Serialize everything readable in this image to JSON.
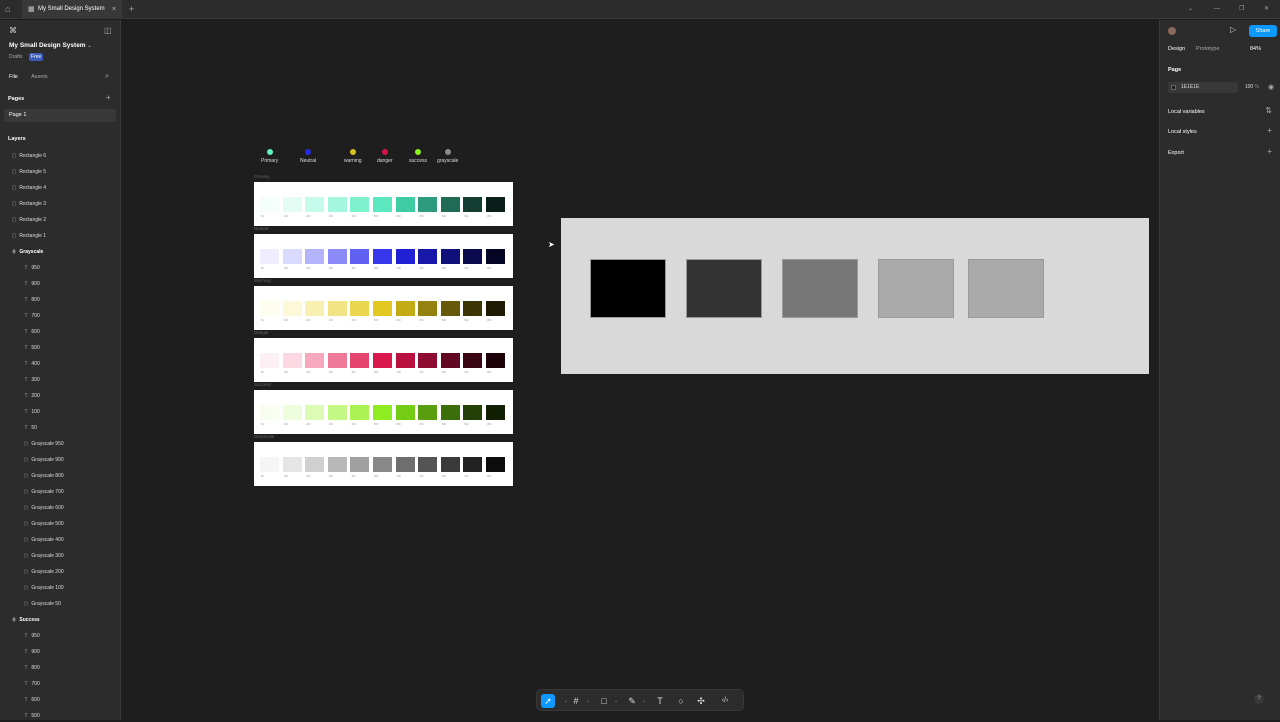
{
  "titlebar": {
    "tab_title": "My Small Design System",
    "new_tab": "+",
    "home_icon": "⌂",
    "close": "×"
  },
  "left_panel": {
    "project_name": "My Small Design System",
    "location": "Drafts",
    "plan_badge": "Free",
    "tabs": [
      "File",
      "Assets"
    ],
    "pages_heading": "Pages",
    "current_page": "Page 1",
    "layers_heading": "Layers",
    "layers": [
      {
        "name": "Rectangle 6",
        "type": "rect",
        "indent": 1
      },
      {
        "name": "Rectangle 5",
        "type": "rect",
        "indent": 1
      },
      {
        "name": "Rectangle 4",
        "type": "rect",
        "indent": 1
      },
      {
        "name": "Rectangle 3",
        "type": "rect",
        "indent": 1
      },
      {
        "name": "Rectangle 2",
        "type": "rect",
        "indent": 1
      },
      {
        "name": "Rectangle 1",
        "type": "rect",
        "indent": 1
      },
      {
        "name": "Grayscale",
        "type": "group",
        "indent": 1
      },
      {
        "name": "950",
        "type": "text",
        "indent": 2
      },
      {
        "name": "900",
        "type": "text",
        "indent": 2
      },
      {
        "name": "800",
        "type": "text",
        "indent": 2
      },
      {
        "name": "700",
        "type": "text",
        "indent": 2
      },
      {
        "name": "600",
        "type": "text",
        "indent": 2
      },
      {
        "name": "500",
        "type": "text",
        "indent": 2
      },
      {
        "name": "400",
        "type": "text",
        "indent": 2
      },
      {
        "name": "300",
        "type": "text",
        "indent": 2
      },
      {
        "name": "200",
        "type": "text",
        "indent": 2
      },
      {
        "name": "100",
        "type": "text",
        "indent": 2
      },
      {
        "name": "50",
        "type": "text",
        "indent": 2
      },
      {
        "name": "Grayscale 950",
        "type": "rect",
        "indent": 2
      },
      {
        "name": "Grayscale 900",
        "type": "rect",
        "indent": 2
      },
      {
        "name": "Grayscale 800",
        "type": "rect",
        "indent": 2
      },
      {
        "name": "Grayscale 700",
        "type": "rect",
        "indent": 2
      },
      {
        "name": "Grayscale 600",
        "type": "rect",
        "indent": 2
      },
      {
        "name": "Grayscale 500",
        "type": "rect",
        "indent": 2
      },
      {
        "name": "Grayscale 400",
        "type": "rect",
        "indent": 2
      },
      {
        "name": "Grayscale 300",
        "type": "rect",
        "indent": 2
      },
      {
        "name": "Grayscale 200",
        "type": "rect",
        "indent": 2
      },
      {
        "name": "Grayscale 100",
        "type": "rect",
        "indent": 2
      },
      {
        "name": "Grayscale 50",
        "type": "rect",
        "indent": 2
      },
      {
        "name": "Success",
        "type": "group",
        "indent": 1
      },
      {
        "name": "950",
        "type": "text",
        "indent": 2
      },
      {
        "name": "900",
        "type": "text",
        "indent": 2
      },
      {
        "name": "800",
        "type": "text",
        "indent": 2
      },
      {
        "name": "700",
        "type": "text",
        "indent": 2
      },
      {
        "name": "600",
        "type": "text",
        "indent": 2
      },
      {
        "name": "500",
        "type": "text",
        "indent": 2
      }
    ]
  },
  "right_panel": {
    "tabs": [
      "Design",
      "Prototype"
    ],
    "zoom": "84%",
    "share_label": "Share",
    "page_heading": "Page",
    "page_color": "1E1E1E",
    "page_opacity": "100",
    "percent": "%",
    "sections": [
      "Local variables",
      "Local styles",
      "Export"
    ]
  },
  "canvas": {
    "legend": [
      {
        "label": "Primary",
        "color": "#5ef2c8"
      },
      {
        "label": "Neutral",
        "color": "#2a2ae6"
      },
      {
        "label": "warning",
        "color": "#d8c21a"
      },
      {
        "label": "danger",
        "color": "#d4154a"
      },
      {
        "label": "success",
        "color": "#8ef21a"
      },
      {
        "label": "grayscale",
        "color": "#8a8a8a"
      }
    ],
    "palettes": [
      {
        "name": "Primary",
        "colors": [
          "#f4fefb",
          "#e3fdf5",
          "#c5fbeb",
          "#a2f7de",
          "#7ef1cf",
          "#5ce8bf",
          "#3fcca2",
          "#2e9c7c",
          "#1f6b56",
          "#143d31",
          "#0a1f19"
        ]
      },
      {
        "name": "Neutral",
        "colors": [
          "#eeeeff",
          "#dadaff",
          "#b4b4fc",
          "#8a8af8",
          "#6060f2",
          "#3636ea",
          "#2020d4",
          "#1818a8",
          "#10107a",
          "#0a0a4c",
          "#050526"
        ]
      },
      {
        "name": "Warning",
        "colors": [
          "#fefdf0",
          "#fcf8d8",
          "#f8f0b0",
          "#f2e484",
          "#ebd650",
          "#e2c820",
          "#c2ab14",
          "#93820f",
          "#66590a",
          "#3c3506",
          "#1e1a03"
        ]
      },
      {
        "name": "Danger",
        "colors": [
          "#fdf0f4",
          "#fbd8e2",
          "#f5a8be",
          "#ee7898",
          "#e4456f",
          "#d8174d",
          "#b8103f",
          "#8e0c31",
          "#620822",
          "#3a0514",
          "#1d020a"
        ]
      },
      {
        "name": "Success",
        "colors": [
          "#f8fef0",
          "#eefddc",
          "#dcfbb4",
          "#c4f885",
          "#aaf352",
          "#8eec20",
          "#74cc14",
          "#589e0f",
          "#3c6e0a",
          "#234106",
          "#112003"
        ]
      },
      {
        "name": "Grayscale",
        "colors": [
          "#f5f5f5",
          "#e5e5e5",
          "#d0d0d0",
          "#b8b8b8",
          "#a0a0a0",
          "#888888",
          "#6e6e6e",
          "#545454",
          "#3a3a3a",
          "#222222",
          "#0c0c0c"
        ]
      }
    ],
    "frame_boxes": [
      "#000000",
      "#333333",
      "#777777",
      "#aaaaaa",
      "#aaaaaa"
    ]
  },
  "toolbar": {
    "tools": [
      "move-tool",
      "frame-tool",
      "shape-tool",
      "pen-tool",
      "text-tool",
      "comment-tool",
      "actions-tool",
      "dev-mode-tool"
    ]
  },
  "help_label": "?"
}
